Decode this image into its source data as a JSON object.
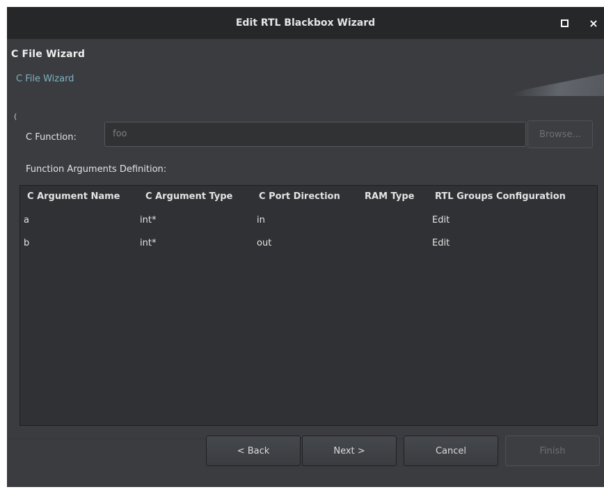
{
  "window": {
    "title": "Edit RTL Blackbox Wizard",
    "maximize_icon": "maximize-icon",
    "close_glyph": "×"
  },
  "header": {
    "page_title": "C File Wizard",
    "page_description": "C File Wizard",
    "stray_glyph": "("
  },
  "form": {
    "c_function_label": "C Function:",
    "c_function_value": "foo",
    "browse_label": "Browse...",
    "args_section_label": "Function Arguments Definition:"
  },
  "table": {
    "columns": [
      "C Argument Name",
      "C Argument Type",
      "C Port Direction",
      "RAM Type",
      "RTL Groups Configuration"
    ],
    "rows": [
      {
        "name": "a",
        "type": "int*",
        "direction": "in",
        "ram_type": "",
        "rtl_config": "Edit"
      },
      {
        "name": "b",
        "type": "int*",
        "direction": "out",
        "ram_type": "",
        "rtl_config": "Edit"
      }
    ]
  },
  "buttons": {
    "back": "< Back",
    "next": "Next >",
    "cancel": "Cancel",
    "finish": "Finish"
  },
  "colors": {
    "titlebar": "#262729",
    "background": "#3a3c3f",
    "description_text": "#7fb3c4"
  }
}
